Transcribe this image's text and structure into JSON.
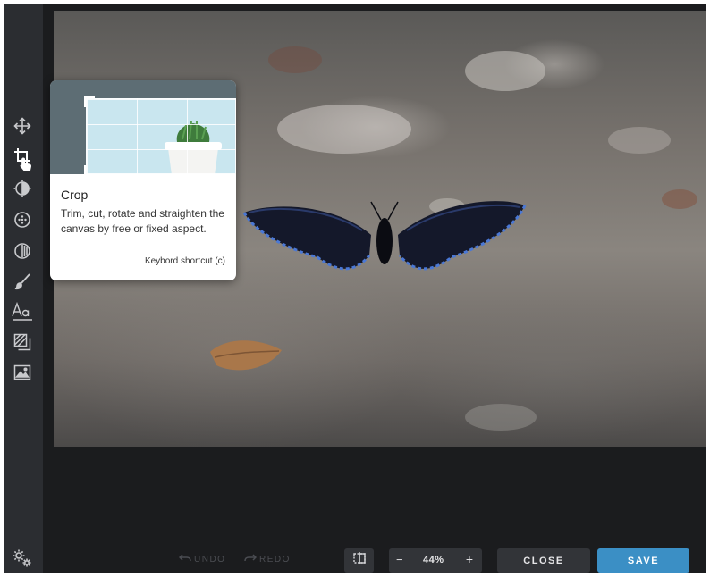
{
  "sidebar": {
    "tools": [
      {
        "icon": "move-icon"
      },
      {
        "icon": "crop-icon"
      },
      {
        "icon": "adjust-icon"
      },
      {
        "icon": "filter-icon"
      },
      {
        "icon": "exposure-icon"
      },
      {
        "icon": "brush-icon"
      },
      {
        "icon": "text-icon"
      },
      {
        "icon": "texture-icon"
      },
      {
        "icon": "image-icon"
      }
    ],
    "settings_icon": "gears-icon"
  },
  "tooltip": {
    "title": "Crop",
    "description": "Trim, cut, rotate and straighten the canvas by free or fixed aspect.",
    "shortcut": "Keybord shortcut (c)"
  },
  "bottombar": {
    "undo_label": "UNDO",
    "redo_label": "REDO",
    "zoom_minus": "−",
    "zoom_value": "44%",
    "zoom_plus": "+",
    "close_label": "CLOSE",
    "save_label": "SAVE"
  },
  "colors": {
    "app_bg": "#1b1c1e",
    "sidebar_bg": "#2b2d31",
    "button_bg": "#323438",
    "save_accent": "#3b8fc5"
  }
}
